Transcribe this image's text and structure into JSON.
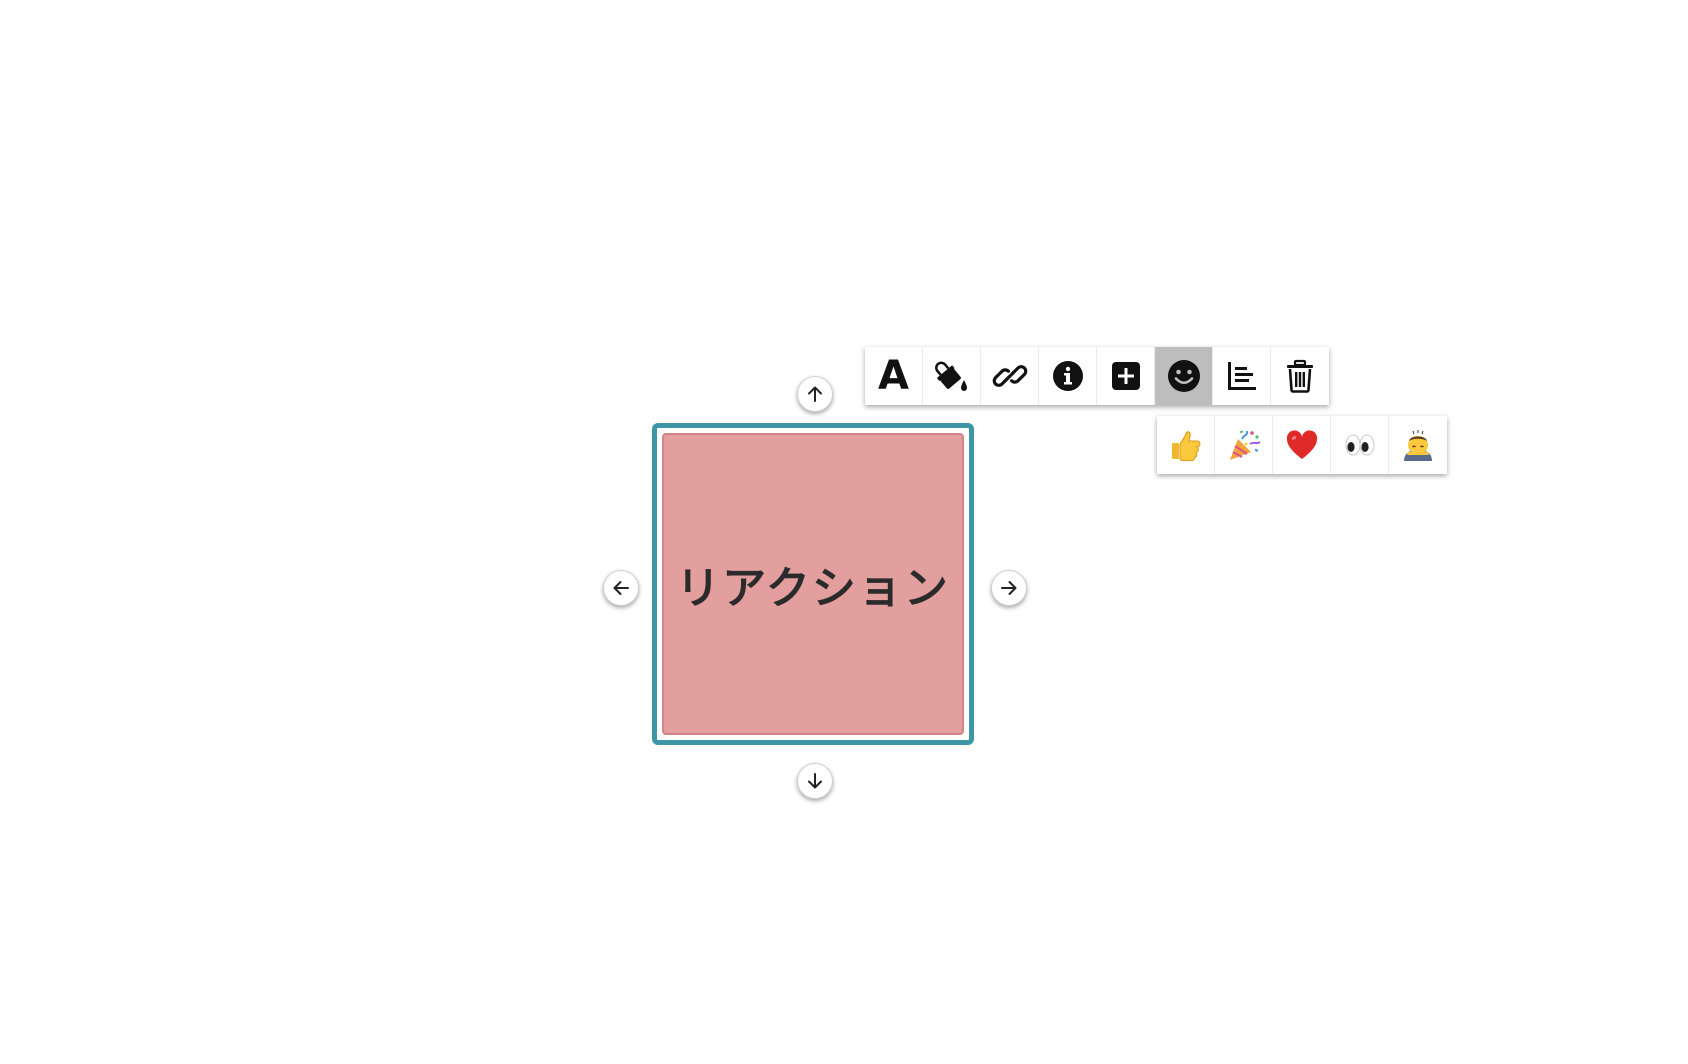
{
  "note": {
    "text": "リアクション",
    "fill_color": "#e39e9e",
    "selection_color": "#3d97a7"
  },
  "handles": {
    "up": "arrow-up-icon",
    "down": "arrow-down-icon",
    "left": "arrow-left-icon",
    "right": "arrow-right-icon"
  },
  "toolbar": {
    "text_style_glyph": "A",
    "active_tool": "reaction",
    "tools": [
      "text-style",
      "fill-color",
      "link",
      "info",
      "add",
      "reaction",
      "align",
      "delete"
    ]
  },
  "reactions": {
    "items": [
      "thumbs-up",
      "party-popper",
      "heart",
      "eyes",
      "bowing-person"
    ]
  }
}
